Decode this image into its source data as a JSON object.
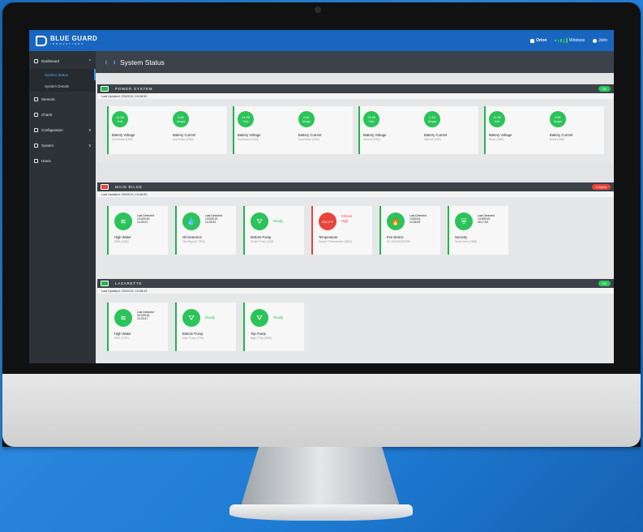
{
  "header": {
    "brand": "BLUE GUARD",
    "brand_sub": "INNOVATIONS",
    "vessel": "Orion",
    "connection": "Wireless",
    "user": "John"
  },
  "sidebar": {
    "items": [
      {
        "label": "Dashboard",
        "icon": "dashboard-icon",
        "chevron": "^"
      },
      {
        "label": "Sensors",
        "icon": "sensors-icon"
      },
      {
        "label": "Charts",
        "icon": "charts-icon"
      },
      {
        "label": "Configuration",
        "icon": "gear-icon",
        "chevron": "v"
      },
      {
        "label": "System",
        "icon": "power-icon",
        "chevron": "v"
      },
      {
        "label": "Users",
        "icon": "users-icon"
      }
    ],
    "sub_items": [
      {
        "label": "System Status",
        "active": true
      },
      {
        "label": "System Details",
        "active": false
      }
    ]
  },
  "page": {
    "title": "System Status"
  },
  "panels": {
    "power": {
      "name": "POWER SYSTEM",
      "status": "OK",
      "last_updated": "Last Updated: 2/5/2019, 15:08:50",
      "groups": [
        {
          "v_val": "11.99",
          "v_unit": "Vdc",
          "v_label": "Battery Voltage",
          "v_src": "Dual Board (1560)",
          "a_val": "0.62",
          "a_unit": "Amps",
          "a_label": "Battery Current",
          "a_src": "Dual Board (1560)"
        },
        {
          "v_val": "11.99",
          "v_unit": "Vdc",
          "v_label": "Battery Voltage",
          "v_src": "Dual Board (1560)",
          "a_val": "0.61",
          "a_unit": "Amps",
          "a_label": "Battery Current",
          "a_src": "Dual Board (1560)"
        },
        {
          "v_val": "13.29",
          "v_unit": "Vdc",
          "v_label": "Battery Voltage",
          "v_src": "Internal (1580)",
          "a_val": "2.16",
          "a_unit": "Amps",
          "a_label": "Battery Current",
          "a_src": "Internal (1580)"
        },
        {
          "v_val": "11.95",
          "v_unit": "Vdc",
          "v_label": "Battery Voltage",
          "v_src": "Boost (1580)",
          "a_val": "0.61",
          "a_unit": "Amps",
          "a_label": "Battery Current",
          "a_src": "Boost (1580)"
        }
      ]
    },
    "bilge": {
      "name": "MAIN BILGE",
      "status": "1 Alarm",
      "last_updated": "Last Updated: 2/5/2019, 15:08:59",
      "cards": [
        {
          "label": "High Water",
          "src": "HWS (1584)",
          "det": "Last Detected",
          "d1": "1/14/2019,",
          "d2": "14:03:23",
          "icon": "waves-icon",
          "alarm": false
        },
        {
          "label": "Oil Detection",
          "src": "Oily Bilge (IO 7990)",
          "det": "Last Detected",
          "d1": "1/23/2019,",
          "d2": "14:03:29",
          "icon": "droplets-icon",
          "alarm": false
        },
        {
          "label": "Bottom Pump",
          "src": "Clutch Pump (1532)",
          "ready": "Ready",
          "icon": "pump-icon",
          "alarm": false
        },
        {
          "label": "Temperature",
          "src": "Sample Thermometer (8380)",
          "val": "234.1°F",
          "c1": "Critical",
          "c2": "High",
          "alarm": true
        },
        {
          "label": "Fire Detect",
          "src": "SD-1900000097908",
          "det": "Last Detected",
          "d1": "1/3/2019,",
          "d2": "10:06:59",
          "icon": "flame-icon",
          "alarm": false
        },
        {
          "label": "Security",
          "src": "Guard Zone (7968)",
          "det": "Last Detected",
          "d1": "1/19/2019,",
          "d2": "18:17:52",
          "icon": "shield-icon",
          "alarm": false
        }
      ]
    },
    "lazarette": {
      "name": "LAZARETTE",
      "status": "OK",
      "last_updated": "Last Updated: 2/5/2019, 15:08:43",
      "cards": [
        {
          "label": "High Water",
          "src": "HWS (1791)",
          "det": "Last Detected",
          "d1": "9/10/2018,",
          "d2": "13:29:47",
          "icon": "waves-icon"
        },
        {
          "label": "Bottom Pump",
          "src": "Main Pump (1791)",
          "ready": "Ready",
          "icon": "pump-icon"
        },
        {
          "label": "Top Pump",
          "src": "Bilge 2 Top (7968)",
          "ready": "Ready",
          "icon": "pump-icon"
        }
      ]
    }
  },
  "colors": {
    "brand_blue": "#1866c0",
    "ok_green": "#2bc35a",
    "alarm_red": "#e8453c",
    "dark_bar": "#3b4249"
  }
}
